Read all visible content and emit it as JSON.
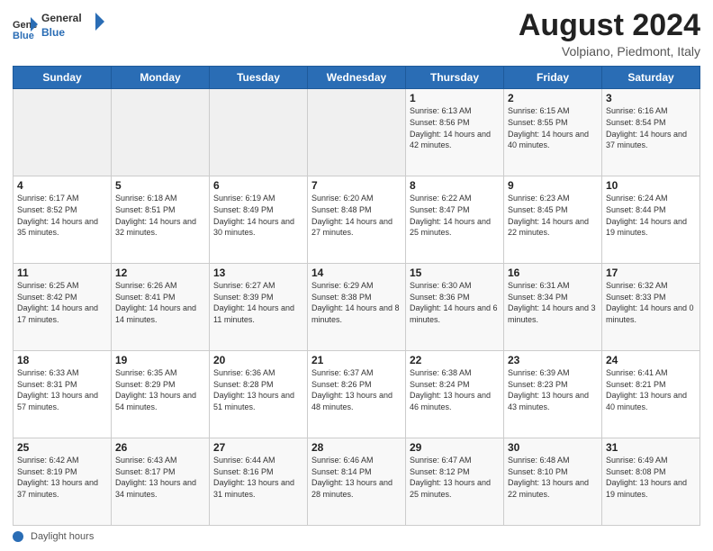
{
  "header": {
    "logo_general": "General",
    "logo_blue": "Blue",
    "title": "August 2024",
    "subtitle": "Volpiano, Piedmont, Italy"
  },
  "calendar": {
    "days_of_week": [
      "Sunday",
      "Monday",
      "Tuesday",
      "Wednesday",
      "Thursday",
      "Friday",
      "Saturday"
    ],
    "weeks": [
      [
        {
          "day": "",
          "info": ""
        },
        {
          "day": "",
          "info": ""
        },
        {
          "day": "",
          "info": ""
        },
        {
          "day": "",
          "info": ""
        },
        {
          "day": "1",
          "info": "Sunrise: 6:13 AM\nSunset: 8:56 PM\nDaylight: 14 hours and 42 minutes."
        },
        {
          "day": "2",
          "info": "Sunrise: 6:15 AM\nSunset: 8:55 PM\nDaylight: 14 hours and 40 minutes."
        },
        {
          "day": "3",
          "info": "Sunrise: 6:16 AM\nSunset: 8:54 PM\nDaylight: 14 hours and 37 minutes."
        }
      ],
      [
        {
          "day": "4",
          "info": "Sunrise: 6:17 AM\nSunset: 8:52 PM\nDaylight: 14 hours and 35 minutes."
        },
        {
          "day": "5",
          "info": "Sunrise: 6:18 AM\nSunset: 8:51 PM\nDaylight: 14 hours and 32 minutes."
        },
        {
          "day": "6",
          "info": "Sunrise: 6:19 AM\nSunset: 8:49 PM\nDaylight: 14 hours and 30 minutes."
        },
        {
          "day": "7",
          "info": "Sunrise: 6:20 AM\nSunset: 8:48 PM\nDaylight: 14 hours and 27 minutes."
        },
        {
          "day": "8",
          "info": "Sunrise: 6:22 AM\nSunset: 8:47 PM\nDaylight: 14 hours and 25 minutes."
        },
        {
          "day": "9",
          "info": "Sunrise: 6:23 AM\nSunset: 8:45 PM\nDaylight: 14 hours and 22 minutes."
        },
        {
          "day": "10",
          "info": "Sunrise: 6:24 AM\nSunset: 8:44 PM\nDaylight: 14 hours and 19 minutes."
        }
      ],
      [
        {
          "day": "11",
          "info": "Sunrise: 6:25 AM\nSunset: 8:42 PM\nDaylight: 14 hours and 17 minutes."
        },
        {
          "day": "12",
          "info": "Sunrise: 6:26 AM\nSunset: 8:41 PM\nDaylight: 14 hours and 14 minutes."
        },
        {
          "day": "13",
          "info": "Sunrise: 6:27 AM\nSunset: 8:39 PM\nDaylight: 14 hours and 11 minutes."
        },
        {
          "day": "14",
          "info": "Sunrise: 6:29 AM\nSunset: 8:38 PM\nDaylight: 14 hours and 8 minutes."
        },
        {
          "day": "15",
          "info": "Sunrise: 6:30 AM\nSunset: 8:36 PM\nDaylight: 14 hours and 6 minutes."
        },
        {
          "day": "16",
          "info": "Sunrise: 6:31 AM\nSunset: 8:34 PM\nDaylight: 14 hours and 3 minutes."
        },
        {
          "day": "17",
          "info": "Sunrise: 6:32 AM\nSunset: 8:33 PM\nDaylight: 14 hours and 0 minutes."
        }
      ],
      [
        {
          "day": "18",
          "info": "Sunrise: 6:33 AM\nSunset: 8:31 PM\nDaylight: 13 hours and 57 minutes."
        },
        {
          "day": "19",
          "info": "Sunrise: 6:35 AM\nSunset: 8:29 PM\nDaylight: 13 hours and 54 minutes."
        },
        {
          "day": "20",
          "info": "Sunrise: 6:36 AM\nSunset: 8:28 PM\nDaylight: 13 hours and 51 minutes."
        },
        {
          "day": "21",
          "info": "Sunrise: 6:37 AM\nSunset: 8:26 PM\nDaylight: 13 hours and 48 minutes."
        },
        {
          "day": "22",
          "info": "Sunrise: 6:38 AM\nSunset: 8:24 PM\nDaylight: 13 hours and 46 minutes."
        },
        {
          "day": "23",
          "info": "Sunrise: 6:39 AM\nSunset: 8:23 PM\nDaylight: 13 hours and 43 minutes."
        },
        {
          "day": "24",
          "info": "Sunrise: 6:41 AM\nSunset: 8:21 PM\nDaylight: 13 hours and 40 minutes."
        }
      ],
      [
        {
          "day": "25",
          "info": "Sunrise: 6:42 AM\nSunset: 8:19 PM\nDaylight: 13 hours and 37 minutes."
        },
        {
          "day": "26",
          "info": "Sunrise: 6:43 AM\nSunset: 8:17 PM\nDaylight: 13 hours and 34 minutes."
        },
        {
          "day": "27",
          "info": "Sunrise: 6:44 AM\nSunset: 8:16 PM\nDaylight: 13 hours and 31 minutes."
        },
        {
          "day": "28",
          "info": "Sunrise: 6:46 AM\nSunset: 8:14 PM\nDaylight: 13 hours and 28 minutes."
        },
        {
          "day": "29",
          "info": "Sunrise: 6:47 AM\nSunset: 8:12 PM\nDaylight: 13 hours and 25 minutes."
        },
        {
          "day": "30",
          "info": "Sunrise: 6:48 AM\nSunset: 8:10 PM\nDaylight: 13 hours and 22 minutes."
        },
        {
          "day": "31",
          "info": "Sunrise: 6:49 AM\nSunset: 8:08 PM\nDaylight: 13 hours and 19 minutes."
        }
      ]
    ]
  },
  "footer": {
    "daylight_label": "Daylight hours"
  }
}
